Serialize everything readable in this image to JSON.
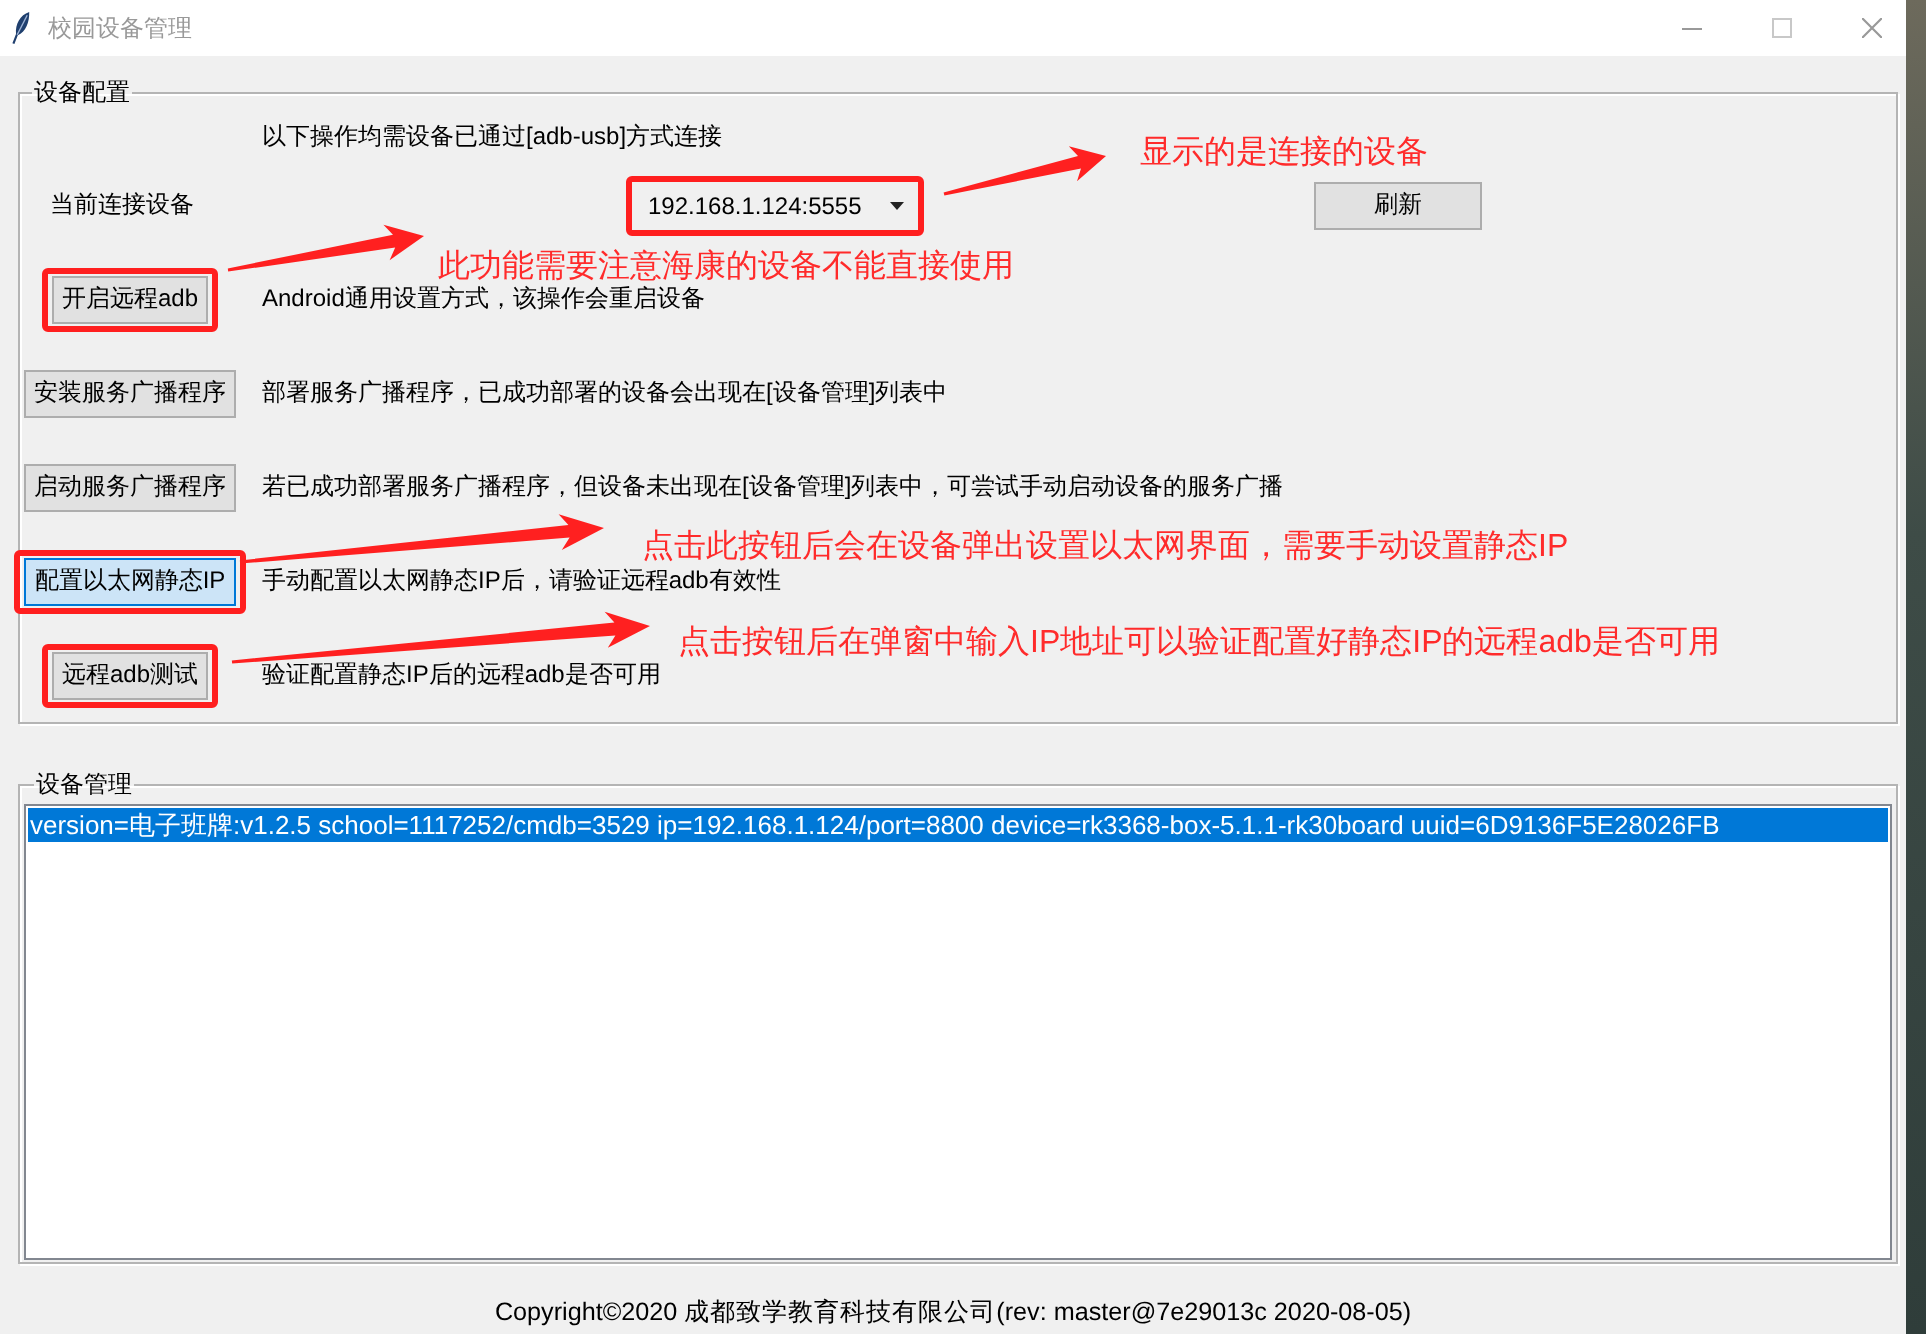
{
  "window": {
    "title": "校园设备管理"
  },
  "device_config": {
    "title": "设备配置",
    "notice": "以下操作均需设备已通过[adb-usb]方式连接",
    "current_device": {
      "label": "当前连接设备",
      "value": "192.168.1.124:5555",
      "annotated": true
    },
    "refresh_button": "刷新",
    "actions": [
      {
        "button": "开启远程adb",
        "description": "Android通用设置方式，该操作会重启设备",
        "annotated": true,
        "focused": false
      },
      {
        "button": "安装服务广播程序",
        "description": "部署服务广播程序，已成功部署的设备会出现在[设备管理]列表中",
        "annotated": false,
        "focused": false
      },
      {
        "button": "启动服务广播程序",
        "description": "若已成功部署服务广播程序，但设备未出现在[设备管理]列表中，可尝试手动启动设备的服务广播",
        "annotated": false,
        "focused": false
      },
      {
        "button": "配置以太网静态IP",
        "description": "手动配置以太网静态IP后，请验证远程adb有效性",
        "annotated": true,
        "focused": true
      },
      {
        "button": "远程adb测试",
        "description": "验证配置静态IP后的远程adb是否可用",
        "annotated": true,
        "focused": false
      }
    ]
  },
  "device_management": {
    "title": "设备管理",
    "items": [
      {
        "text": "version=电子班牌:v1.2.5 school=1117252/cmdb=3529 ip=192.168.1.124/port=8800 device=rk3368-box-5.1.1-rk30board uuid=6D9136F5E28026FB",
        "selected": true
      }
    ]
  },
  "annotations": [
    {
      "text": "显示的是连接的设备"
    },
    {
      "text": "此功能需要注意海康的设备不能直接使用"
    },
    {
      "text": "点击此按钮后会在设备弹出设置以太网界面，需要手动设置静态IP"
    },
    {
      "text": "点击按钮后在弹窗中输入IP地址可以验证配置好静态IP的远程adb是否可用"
    }
  ],
  "footer": "Copyright©2020 成都致学教育科技有限公司(rev: master@7e29013c 2020-08-05)"
}
